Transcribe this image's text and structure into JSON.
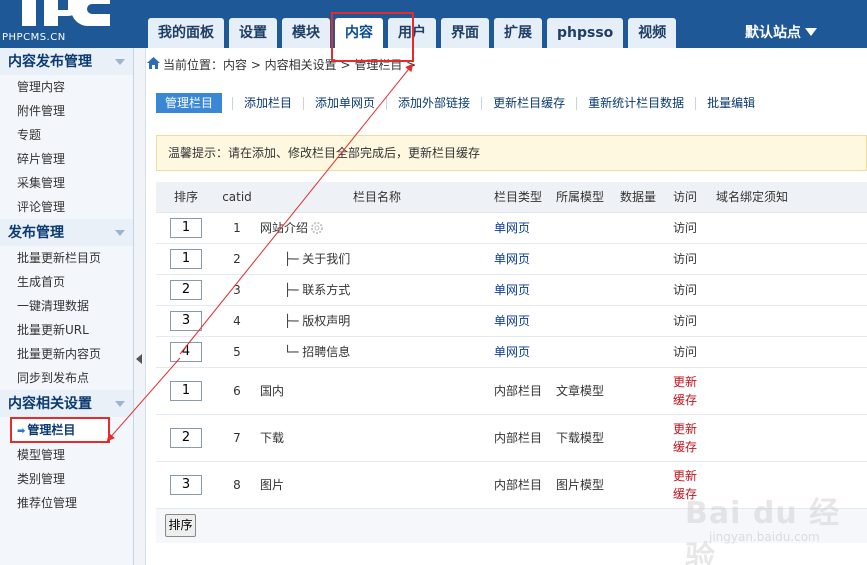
{
  "logo": {
    "text": "PHPCMS.CN"
  },
  "nav": {
    "tabs": [
      {
        "label": "我的面板"
      },
      {
        "label": "设置"
      },
      {
        "label": "模块"
      },
      {
        "label": "内容"
      },
      {
        "label": "用户"
      },
      {
        "label": "界面"
      },
      {
        "label": "扩展"
      },
      {
        "label": "phpsso"
      },
      {
        "label": "视频"
      }
    ],
    "site_select": "默认站点"
  },
  "sidebar": {
    "sections": [
      {
        "title": "内容发布管理",
        "items": [
          "管理内容",
          "附件管理",
          "专题",
          "碎片管理",
          "采集管理",
          "评论管理"
        ]
      },
      {
        "title": "发布管理",
        "items": [
          "批量更新栏目页",
          "生成首页",
          "一键清理数据",
          "批量更新URL",
          "批量更新内容页",
          "同步到发布点"
        ]
      },
      {
        "title": "内容相关设置",
        "items": [
          "管理栏目",
          "模型管理",
          "类别管理",
          "推荐位管理"
        ]
      }
    ]
  },
  "breadcrumb": {
    "text": "当前位置：内容 > 内容相关设置 > 管理栏目 >"
  },
  "subnav": {
    "items": [
      "管理栏目",
      "添加栏目",
      "添加单网页",
      "添加外部链接",
      "更新栏目缓存",
      "重新统计栏目数据",
      "批量编辑"
    ]
  },
  "notice": {
    "text": "温馨提示：请在添加、修改栏目全部完成后，更新栏目缓存"
  },
  "table": {
    "headers": [
      "排序",
      "catid",
      "栏目名称",
      "栏目类型",
      "所属模型",
      "数据量",
      "访问",
      "域名绑定须知"
    ],
    "rows": [
      {
        "sort": "1",
        "catid": "1",
        "prefix": "",
        "name": "网站介绍",
        "type": "单网页",
        "model": "",
        "count": "",
        "visit": "访问"
      },
      {
        "sort": "1",
        "catid": "2",
        "prefix": "├─ ",
        "name": "关于我们",
        "type": "单网页",
        "model": "",
        "count": "",
        "visit": "访问"
      },
      {
        "sort": "2",
        "catid": "3",
        "prefix": "├─ ",
        "name": "联系方式",
        "type": "单网页",
        "model": "",
        "count": "",
        "visit": "访问"
      },
      {
        "sort": "3",
        "catid": "4",
        "prefix": "├─ ",
        "name": "版权声明",
        "type": "单网页",
        "model": "",
        "count": "",
        "visit": "访问"
      },
      {
        "sort": "4",
        "catid": "5",
        "prefix": "└─ ",
        "name": "招聘信息",
        "type": "单网页",
        "model": "",
        "count": "",
        "visit": "访问"
      },
      {
        "sort": "1",
        "catid": "6",
        "prefix": "",
        "name": "国内",
        "type": "内部栏目",
        "model": "文章模型",
        "count": "",
        "visit_line1": "更新",
        "visit_line2": "缓存"
      },
      {
        "sort": "2",
        "catid": "7",
        "prefix": "",
        "name": "下载",
        "type": "内部栏目",
        "model": "下载模型",
        "count": "",
        "visit_line1": "更新",
        "visit_line2": "缓存"
      },
      {
        "sort": "3",
        "catid": "8",
        "prefix": "",
        "name": "图片",
        "type": "内部栏目",
        "model": "图片模型",
        "count": "",
        "visit_line1": "更新",
        "visit_line2": "缓存"
      }
    ]
  },
  "sort_button": {
    "label": "排序"
  },
  "watermark": {
    "main": "Bai du 经验",
    "sub": "jingyan.baidu.com"
  },
  "colors": {
    "header": "#1f5897",
    "accent": "#3a87d6",
    "annotation": "#e52c2c",
    "refresh": "#c2141d"
  }
}
